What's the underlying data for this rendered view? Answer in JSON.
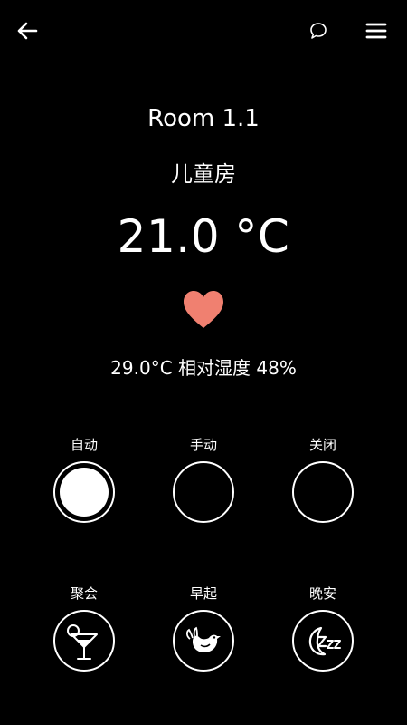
{
  "header": {
    "back_icon": "back-arrow-icon",
    "chat_icon": "chat-bubble-icon",
    "menu_icon": "hamburger-menu-icon"
  },
  "room": {
    "name": "Room 1.1",
    "subtitle": "儿童房",
    "setpoint": "21.0 °C",
    "heart_color": "#f08070",
    "status": "29.0°C  相对湿度 48%"
  },
  "modes": [
    {
      "label": "自动",
      "active": true
    },
    {
      "label": "手动",
      "active": false
    },
    {
      "label": "关闭",
      "active": false
    }
  ],
  "scenes": [
    {
      "label": "聚会",
      "icon": "cocktail-glass-icon"
    },
    {
      "label": "早起",
      "icon": "bird-icon"
    },
    {
      "label": "晚安",
      "icon": "moon-sleep-icon"
    }
  ]
}
